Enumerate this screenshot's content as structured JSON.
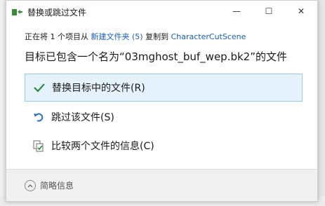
{
  "dialog": {
    "title": "替换或跳过文件",
    "controls": {
      "minimize": "—",
      "maximize": "☐",
      "close": "✕"
    },
    "status": {
      "prefix": "正在将 1 个项目从",
      "source": "新建文件夹 (5)",
      "middle": "复制到",
      "destination": "CharacterCutScene"
    },
    "message": "目标已包含一个名为“03mghost_buf_wep.bk2”的文件",
    "options": [
      {
        "label": "替换目标中的文件(R)",
        "icon": "check-icon"
      },
      {
        "label": "跳过该文件(S)",
        "icon": "skip-icon"
      },
      {
        "label": "比较两个文件的信息(C)",
        "icon": "compare-icon"
      }
    ],
    "details_label": "简略信息"
  },
  "colors": {
    "accent": "#1a5fb4",
    "selected_bg": "#e5f1fb",
    "check": "#2e8b3e"
  }
}
